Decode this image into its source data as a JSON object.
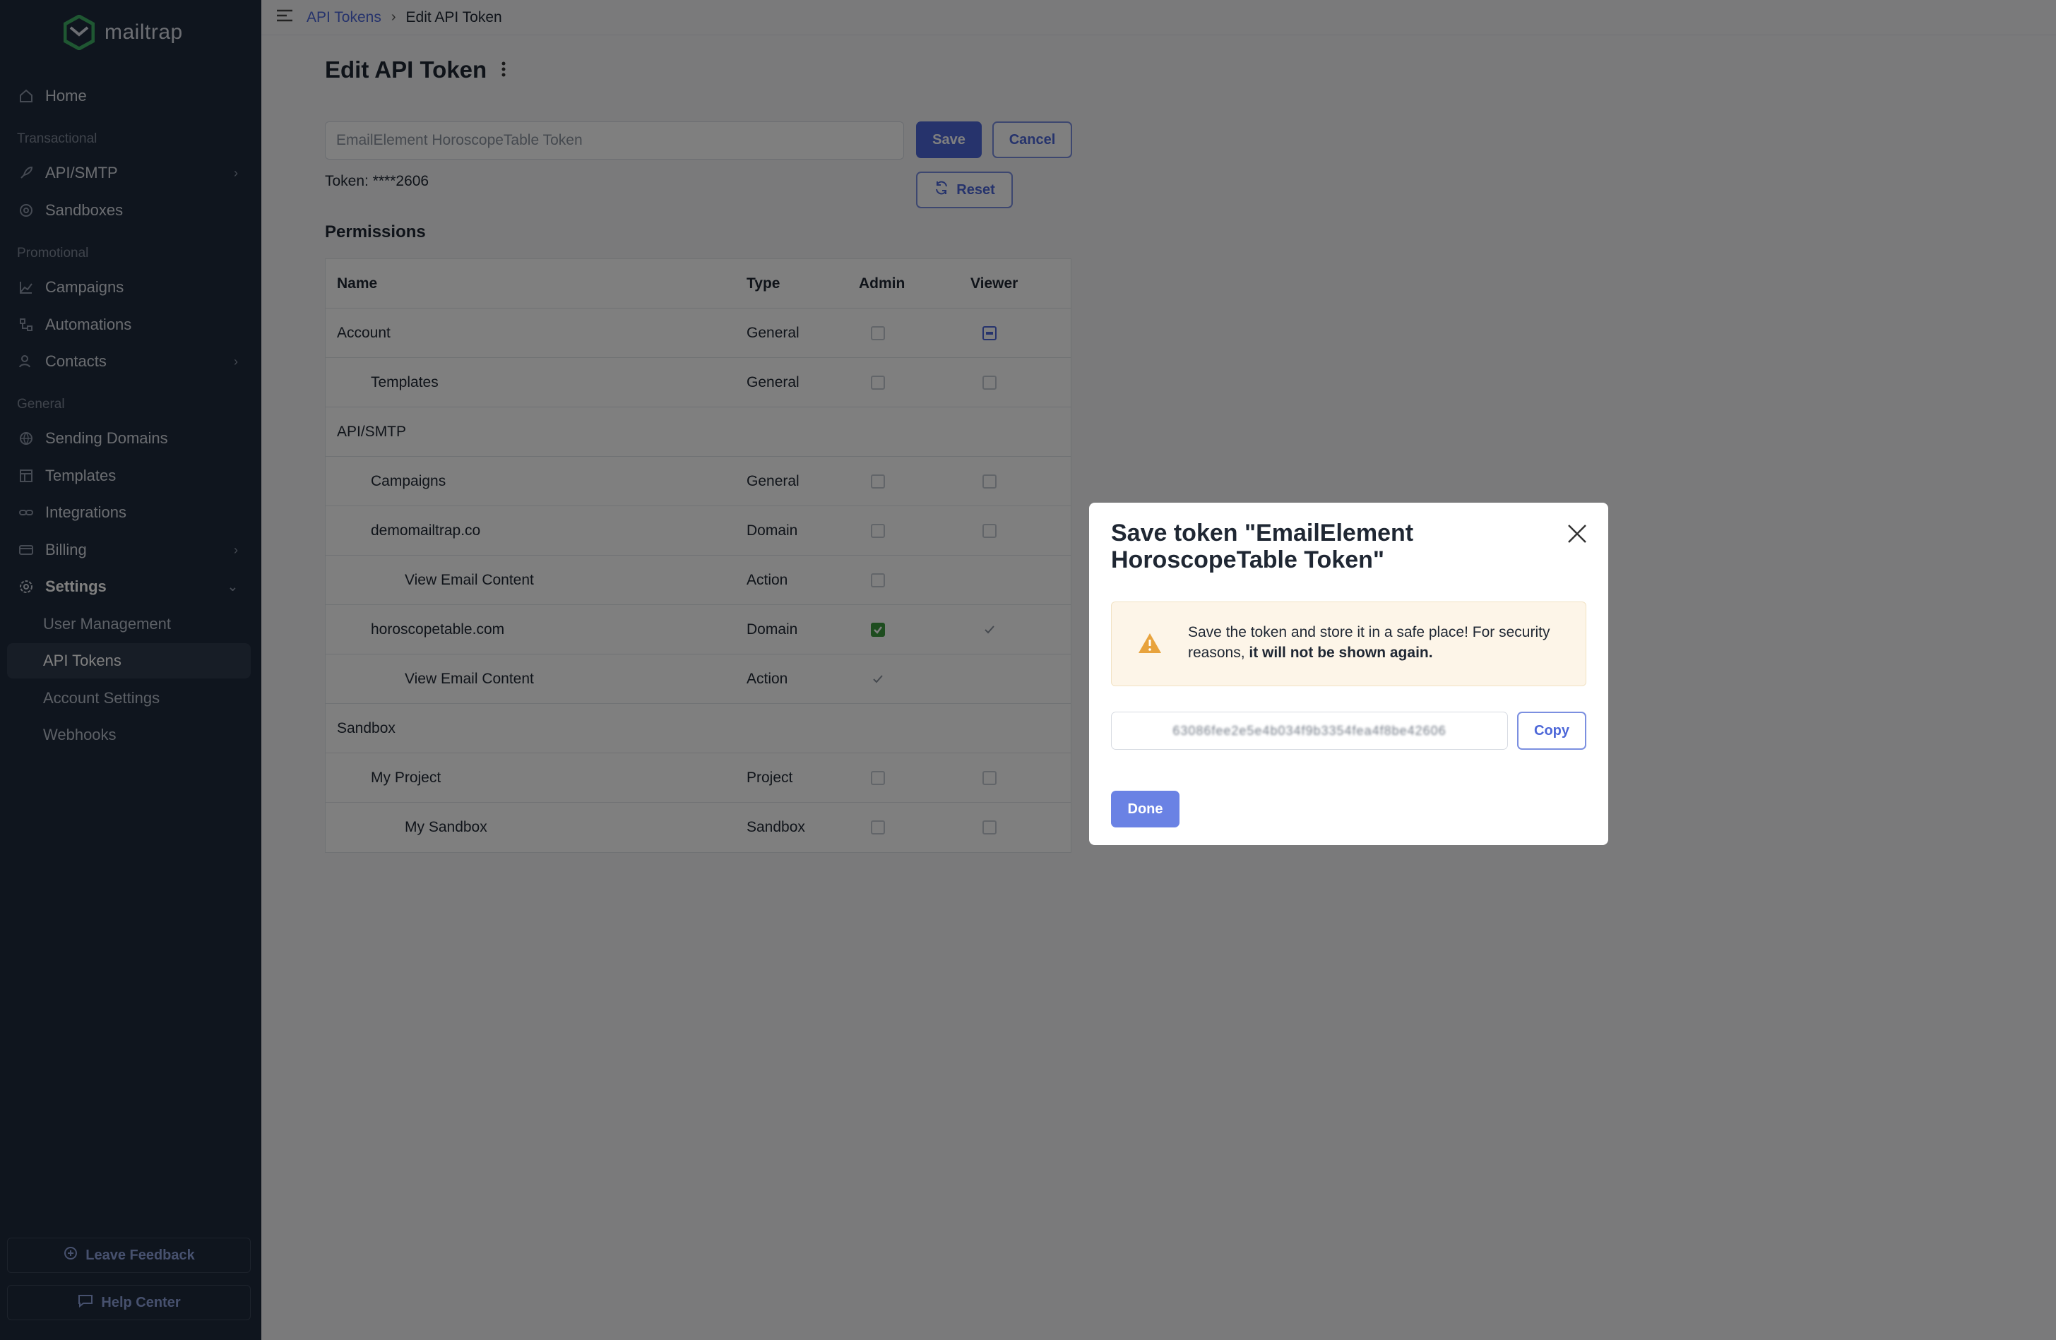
{
  "brand": {
    "name": "mailtrap",
    "color": "#4d67d8"
  },
  "sidebar": {
    "home": "Home",
    "section_transactional": "Transactional",
    "api_smtp": "API/SMTP",
    "sandboxes": "Sandboxes",
    "section_promotional": "Promotional",
    "campaigns": "Campaigns",
    "automations": "Automations",
    "contacts": "Contacts",
    "section_general": "General",
    "sending_domains": "Sending Domains",
    "templates": "Templates",
    "integrations": "Integrations",
    "billing": "Billing",
    "settings": "Settings",
    "user_management": "User Management",
    "api_tokens": "API Tokens",
    "account_settings": "Account Settings",
    "webhooks": "Webhooks",
    "leave_feedback": "Leave Feedback",
    "help_center": "Help Center"
  },
  "breadcrumb": {
    "parent": "API Tokens",
    "separator": "›",
    "current": "Edit API Token"
  },
  "page": {
    "title": "Edit API Token",
    "token_name_value": "EmailElement HoroscopeTable Token",
    "save": "Save",
    "cancel": "Cancel",
    "reset": "Reset",
    "token_masked": "Token: ****2606",
    "permissions_title": "Permissions"
  },
  "permissions": {
    "headers": {
      "name": "Name",
      "type": "Type",
      "admin": "Admin",
      "viewer": "Viewer"
    },
    "rows": [
      {
        "name": "Account",
        "type": "General",
        "indent": 0,
        "admin": "unchecked",
        "viewer": "indeterminate"
      },
      {
        "name": "Templates",
        "type": "General",
        "indent": 1,
        "admin": "unchecked",
        "viewer": "unchecked"
      },
      {
        "name": "API/SMTP",
        "type": "",
        "indent": 0,
        "admin": "none",
        "viewer": "none"
      },
      {
        "name": "Campaigns",
        "type": "General",
        "indent": 1,
        "admin": "unchecked",
        "viewer": "unchecked"
      },
      {
        "name": "demomailtrap.co",
        "type": "Domain",
        "indent": 1,
        "admin": "unchecked",
        "viewer": "unchecked"
      },
      {
        "name": "View Email Content",
        "type": "Action",
        "indent": 2,
        "admin": "unchecked",
        "viewer": "none"
      },
      {
        "name": "horoscopetable.com",
        "type": "Domain",
        "indent": 1,
        "admin": "checked",
        "viewer": "checked"
      },
      {
        "name": "View Email Content",
        "type": "Action",
        "indent": 2,
        "admin": "checked",
        "viewer": "none"
      },
      {
        "name": "Sandbox",
        "type": "",
        "indent": 0,
        "admin": "none",
        "viewer": "none"
      },
      {
        "name": "My Project",
        "type": "Project",
        "indent": 1,
        "admin": "unchecked",
        "viewer": "unchecked"
      },
      {
        "name": "My Sandbox",
        "type": "Sandbox",
        "indent": 2,
        "admin": "unchecked",
        "viewer": "unchecked"
      }
    ]
  },
  "modal": {
    "title": "Save token \"EmailElement HoroscopeTable Token\"",
    "warning_text": "Save the token and store it in a safe place! For security reasons,",
    "warning_bold": "it will not be shown again.",
    "token_value": "63086fee2e5e4b034f9b3354fea4f8be42606",
    "copy": "Copy",
    "done": "Done"
  }
}
